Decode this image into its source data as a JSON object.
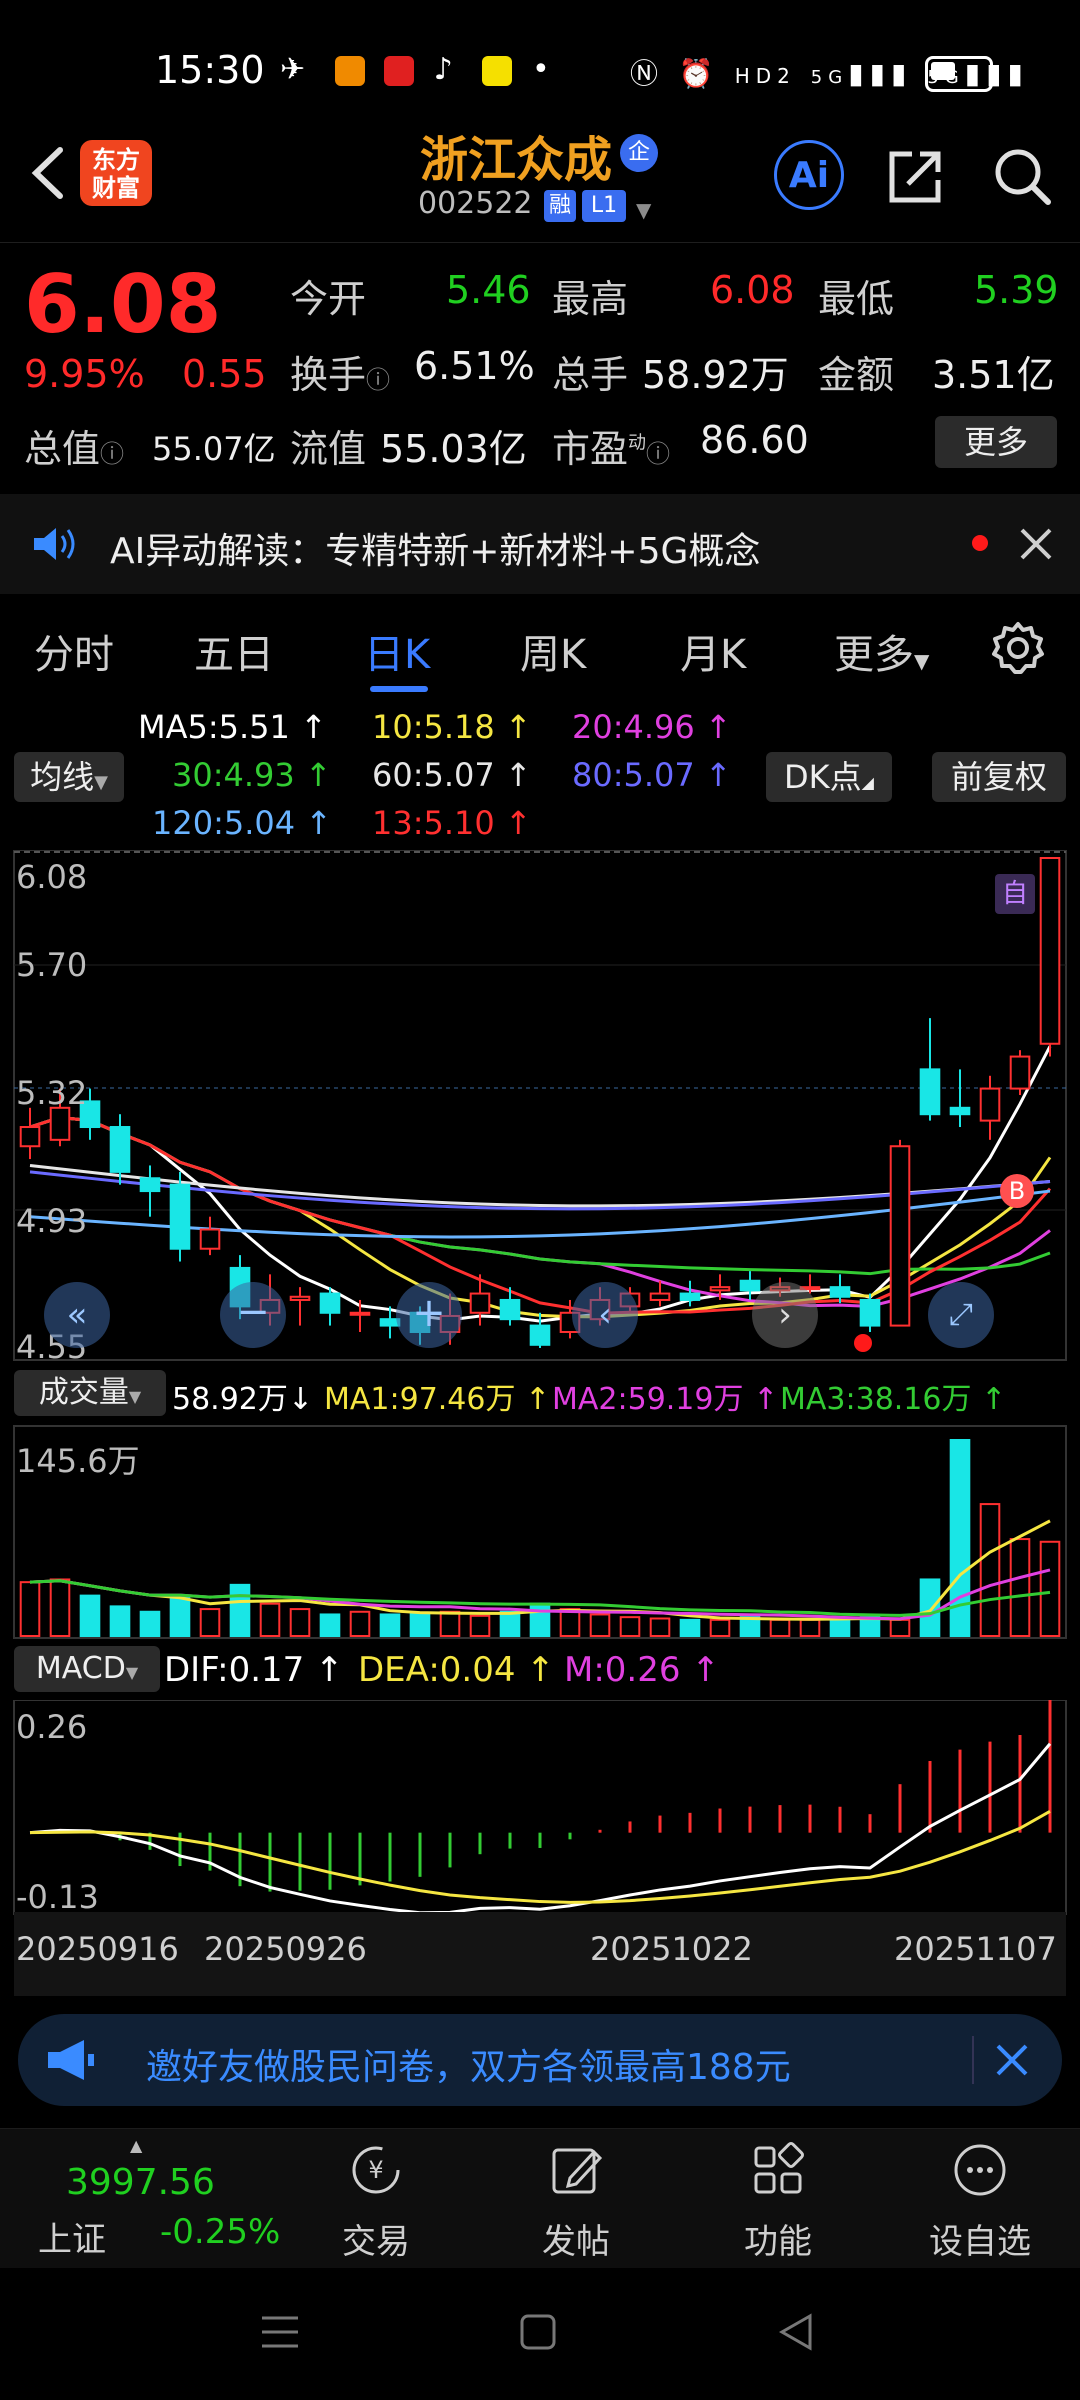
{
  "status_bar": {
    "time": "15:30",
    "net1": "5G",
    "net2": "5G",
    "hd": "HD2"
  },
  "header": {
    "stock_name": "浙江众成",
    "qi_badge": "企",
    "stock_code": "002522",
    "rong_badge": "融",
    "level_badge": "L1",
    "logo_line1": "东方",
    "logo_line2": "财富",
    "ai_label": "Ai"
  },
  "quote": {
    "price": "6.08",
    "pct": "9.95%",
    "change": "0.55",
    "open_label": "今开",
    "open": "5.46",
    "high_label": "最高",
    "high": "6.08",
    "low_label": "最低",
    "low": "5.39",
    "turnover_label": "换手",
    "turnover": "6.51%",
    "volume_label": "总手",
    "volume": "58.92万",
    "amount_label": "金额",
    "amount": "3.51亿",
    "mktcap_label": "总值",
    "mktcap": "55.07亿",
    "float_label": "流值",
    "float": "55.03亿",
    "pe_label": "市盈",
    "pe_sup": "动",
    "pe": "86.60",
    "more_label": "更多"
  },
  "ai_banner": {
    "text": "AI异动解读：专精特新+新材料+5G概念"
  },
  "tabs": [
    {
      "label": "分时"
    },
    {
      "label": "五日"
    },
    {
      "label": "日K"
    },
    {
      "label": "周K"
    },
    {
      "label": "月K"
    },
    {
      "label": "更多"
    }
  ],
  "ma_legend": {
    "selector": "均线",
    "ma5": "MA5:5.51",
    "ma10": "10:5.18",
    "ma20": "20:4.96",
    "ma30": "30:4.93",
    "ma60": "60:5.07",
    "ma80": "80:5.07",
    "ma120": "120:5.04",
    "ma13": "13:5.10",
    "dk_label": "DK点",
    "fq_label": "前复权",
    "arrow": "↑"
  },
  "colors": {
    "ma5": "#ffffff",
    "ma10": "#f5e642",
    "ma20": "#e040e0",
    "ma30": "#33cc33",
    "ma60": "#e6e6e6",
    "ma80": "#6a6aff",
    "ma120": "#6ab4ff",
    "ma13": "#ff3030",
    "up": "#ff3030",
    "down": "#19e6e6"
  },
  "price_axis": {
    "top": "6.08",
    "l2": "5.70",
    "l3": "5.32",
    "l4": "4.93",
    "bottom": "4.55"
  },
  "markers": {
    "zi": "自",
    "b": "B"
  },
  "volume_panel": {
    "selector": "成交量",
    "value": "58.92万",
    "down_arrow": "↓",
    "ma1": "MA1:97.46万",
    "ma2": "MA2:59.19万",
    "ma3": "MA3:38.16万",
    "axis_top": "145.6万"
  },
  "macd_panel": {
    "selector": "MACD",
    "dif": "DIF:0.17",
    "dea": "DEA:0.04",
    "m": "M:0.26",
    "axis_top": "0.26",
    "axis_bottom": "-0.13"
  },
  "dates": {
    "d1": "20250916",
    "d2": "20250926",
    "d3": "20251022",
    "d4": "20251107"
  },
  "chart_data": {
    "type": "candlestick",
    "title": "",
    "ylim": [
      4.55,
      6.08
    ],
    "candles": [
      {
        "o": 5.18,
        "c": 5.24,
        "h": 5.3,
        "l": 5.14
      },
      {
        "o": 5.2,
        "c": 5.3,
        "h": 5.36,
        "l": 5.18
      },
      {
        "o": 5.32,
        "c": 5.24,
        "h": 5.36,
        "l": 5.2
      },
      {
        "o": 5.24,
        "c": 5.1,
        "h": 5.28,
        "l": 5.06
      },
      {
        "o": 5.08,
        "c": 5.04,
        "h": 5.12,
        "l": 4.96
      },
      {
        "o": 5.06,
        "c": 4.86,
        "h": 5.1,
        "l": 4.82
      },
      {
        "o": 4.86,
        "c": 4.92,
        "h": 4.96,
        "l": 4.84
      },
      {
        "o": 4.8,
        "c": 4.68,
        "h": 4.84,
        "l": 4.64
      },
      {
        "o": 4.66,
        "c": 4.7,
        "h": 4.78,
        "l": 4.62
      },
      {
        "o": 4.7,
        "c": 4.71,
        "h": 4.74,
        "l": 4.62
      },
      {
        "o": 4.72,
        "c": 4.66,
        "h": 4.74,
        "l": 4.62
      },
      {
        "o": 4.66,
        "c": 4.66,
        "h": 4.7,
        "l": 4.6
      },
      {
        "o": 4.64,
        "c": 4.62,
        "h": 4.68,
        "l": 4.58
      },
      {
        "o": 4.66,
        "c": 4.6,
        "h": 4.68,
        "l": 4.56
      },
      {
        "o": 4.6,
        "c": 4.65,
        "h": 4.72,
        "l": 4.56
      },
      {
        "o": 4.66,
        "c": 4.72,
        "h": 4.78,
        "l": 4.62
      },
      {
        "o": 4.7,
        "c": 4.64,
        "h": 4.74,
        "l": 4.62
      },
      {
        "o": 4.62,
        "c": 4.56,
        "h": 4.66,
        "l": 4.55
      },
      {
        "o": 4.6,
        "c": 4.66,
        "h": 4.7,
        "l": 4.58
      },
      {
        "o": 4.64,
        "c": 4.7,
        "h": 4.74,
        "l": 4.62
      },
      {
        "o": 4.68,
        "c": 4.72,
        "h": 4.74,
        "l": 4.66
      },
      {
        "o": 4.7,
        "c": 4.72,
        "h": 4.76,
        "l": 4.68
      },
      {
        "o": 4.72,
        "c": 4.7,
        "h": 4.76,
        "l": 4.68
      },
      {
        "o": 4.73,
        "c": 4.74,
        "h": 4.78,
        "l": 4.7
      },
      {
        "o": 4.76,
        "c": 4.73,
        "h": 4.79,
        "l": 4.7
      },
      {
        "o": 4.73,
        "c": 4.74,
        "h": 4.77,
        "l": 4.71
      },
      {
        "o": 4.74,
        "c": 4.74,
        "h": 4.78,
        "l": 4.72
      },
      {
        "o": 4.74,
        "c": 4.71,
        "h": 4.78,
        "l": 4.69
      },
      {
        "o": 4.7,
        "c": 4.62,
        "h": 4.72,
        "l": 4.6
      },
      {
        "o": 4.62,
        "c": 5.18,
        "h": 5.2,
        "l": 4.62
      },
      {
        "o": 5.42,
        "c": 5.28,
        "h": 5.58,
        "l": 5.26
      },
      {
        "o": 5.3,
        "c": 5.28,
        "h": 5.42,
        "l": 5.24
      },
      {
        "o": 5.26,
        "c": 5.36,
        "h": 5.4,
        "l": 5.2
      },
      {
        "o": 5.36,
        "c": 5.46,
        "h": 5.48,
        "l": 5.34
      },
      {
        "o": 5.5,
        "c": 6.08,
        "h": 6.08,
        "l": 5.46
      }
    ],
    "volume": [
      40,
      42,
      30,
      22,
      18,
      30,
      20,
      38,
      24,
      20,
      16,
      18,
      16,
      17,
      18,
      15,
      18,
      24,
      20,
      16,
      14,
      13,
      12,
      12,
      14,
      12,
      12,
      13,
      14,
      12,
      42,
      145.6,
      98,
      72,
      70
    ]
  }
}
